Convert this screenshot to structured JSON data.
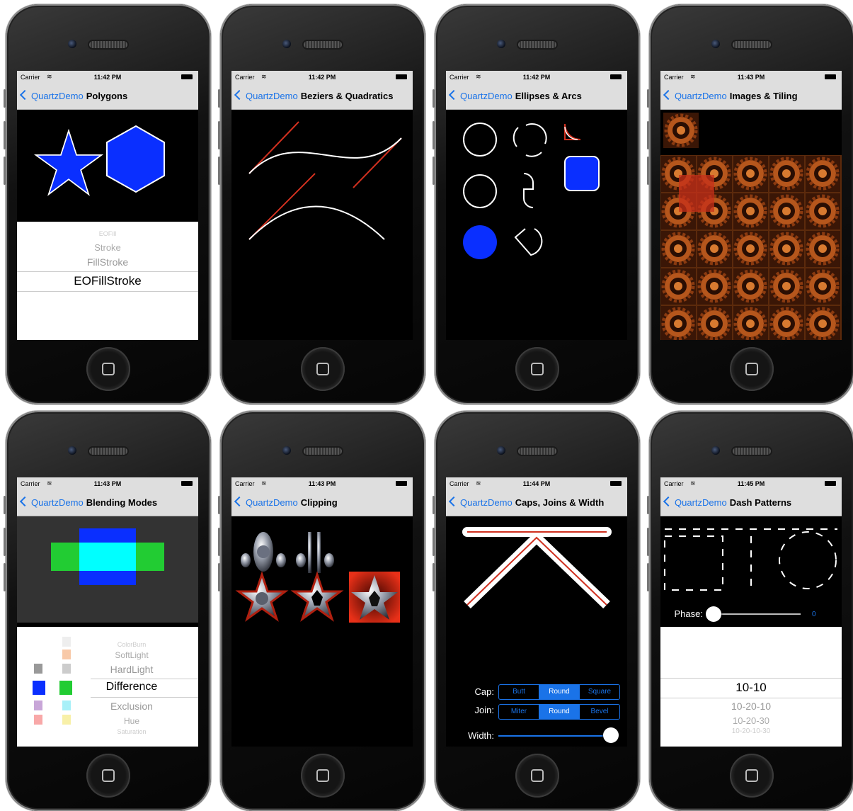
{
  "carrier": "Carrier",
  "back_label": "QuartzDemo",
  "phones": [
    {
      "time": "11:42 PM",
      "title": "Polygons"
    },
    {
      "time": "11:42 PM",
      "title": "Beziers & Quadratics"
    },
    {
      "time": "11:42 PM",
      "title": "Ellipses & Arcs"
    },
    {
      "time": "11:43 PM",
      "title": "Images & Tiling"
    },
    {
      "time": "11:43 PM",
      "title": "Blending Modes"
    },
    {
      "time": "11:43 PM",
      "title": "Clipping"
    },
    {
      "time": "11:44 PM",
      "title": "Caps, Joins & Width"
    },
    {
      "time": "11:45 PM",
      "title": "Dash Patterns"
    }
  ],
  "polygons": {
    "picker": [
      "EOFill",
      "Stroke",
      "FillStroke",
      "EOFillStroke"
    ],
    "selected": "EOFillStroke"
  },
  "blending": {
    "picker": [
      "ColorBurn",
      "SoftLight",
      "HardLight",
      "Difference",
      "Exclusion",
      "Hue",
      "Saturation"
    ],
    "selected": "Difference"
  },
  "caps": {
    "cap_label": "Cap:",
    "join_label": "Join:",
    "width_label": "Width:",
    "cap_options": [
      "Butt",
      "Round",
      "Square"
    ],
    "cap_selected": "Round",
    "join_options": [
      "Miter",
      "Round",
      "Bevel"
    ],
    "join_selected": "Round",
    "width_level": 1.0
  },
  "dash": {
    "phase_label": "Phase:",
    "phase_value": "0",
    "picker": [
      "10-10",
      "10-20-10",
      "10-20-30",
      "10-20-10-30"
    ],
    "selected": "10-10"
  },
  "colors": {
    "accent": "#1a73e8",
    "shape_blue": "#0a2fff",
    "line_red": "#d0301f",
    "status_bg": "#dedede"
  }
}
